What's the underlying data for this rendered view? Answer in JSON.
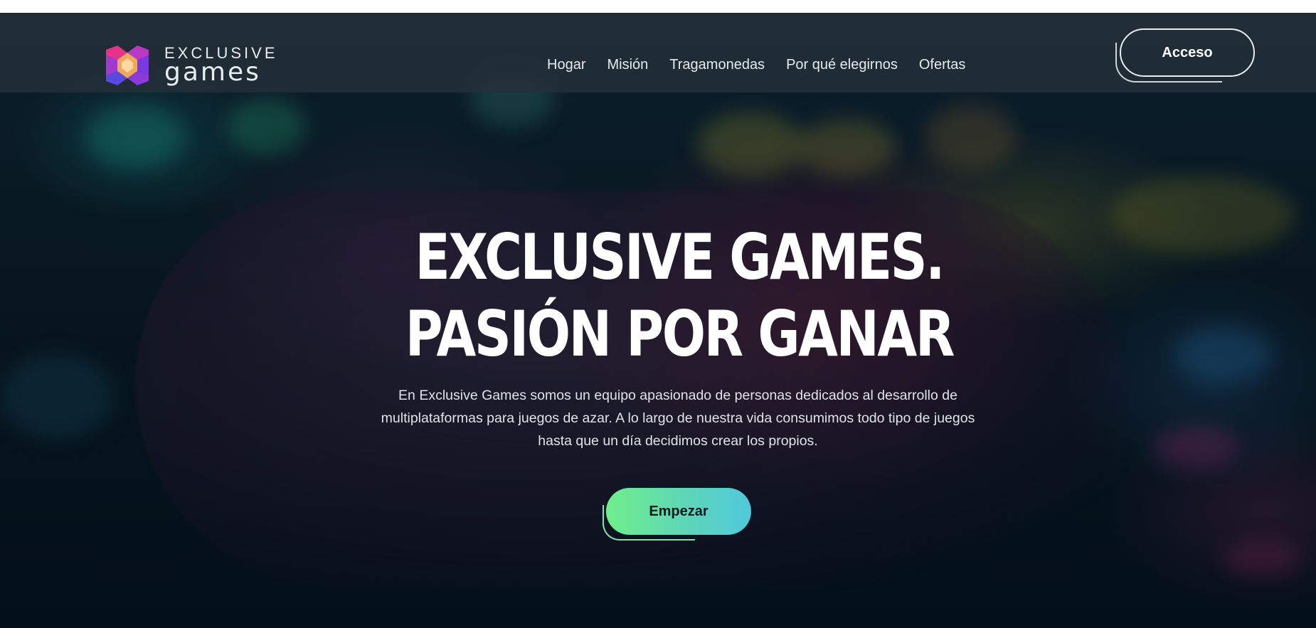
{
  "brand": {
    "logo_line1": "EXCLUSIVE",
    "logo_line2": "games",
    "logo_colors": [
      "#e7328a",
      "#8a3ad8",
      "#f0a85c",
      "#5a49e0"
    ]
  },
  "nav": {
    "items": [
      {
        "label": "Hogar"
      },
      {
        "label": "Misión"
      },
      {
        "label": "Tragamonedas"
      },
      {
        "label": "Por qué elegirnos"
      },
      {
        "label": "Ofertas"
      }
    ],
    "login_label": "Acceso"
  },
  "hero": {
    "title_line1": "EXCLUSIVE GAMES.",
    "title_line2": "PASIÓN POR GANAR",
    "description": "En Exclusive Games somos un equipo apasionado de personas dedicados al desarrollo de multiplataformas para juegos de azar. A lo largo de nuestra vida consumimos todo tipo de juegos hasta que un día decidimos crear los propios.",
    "cta_label": "Empezar",
    "cta_gradient": [
      "#6fef8c",
      "#4fc9dc"
    ]
  }
}
